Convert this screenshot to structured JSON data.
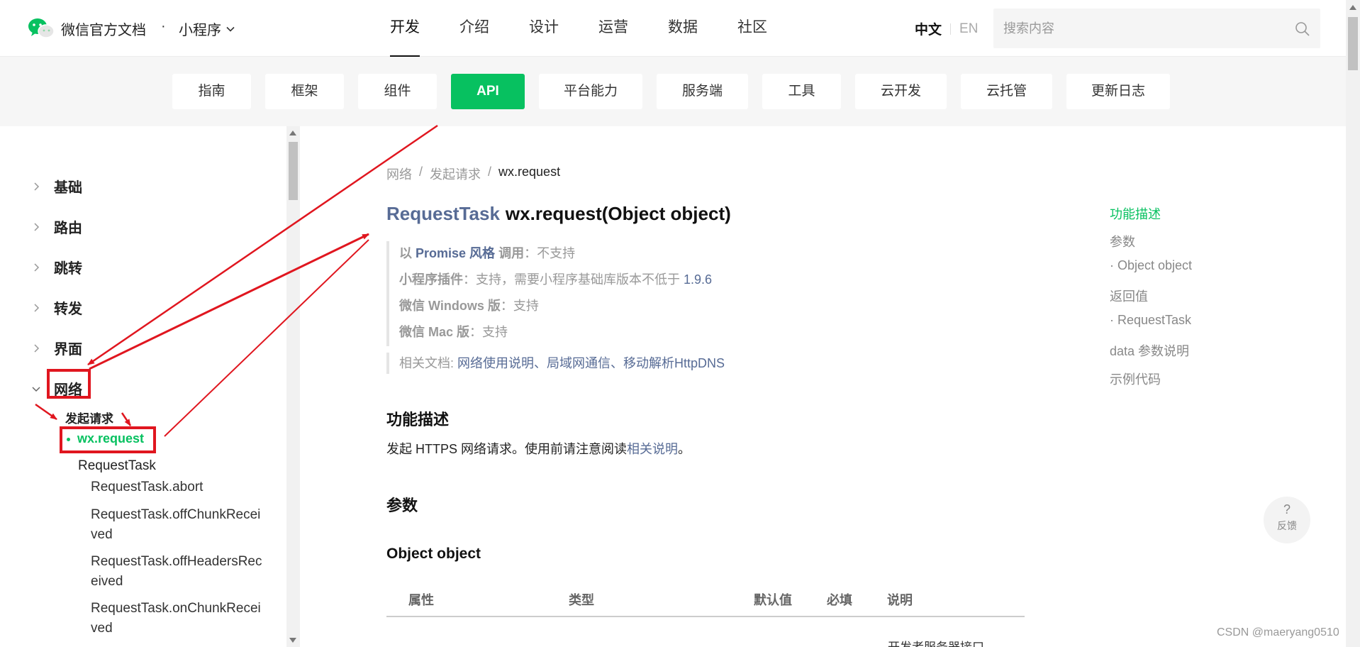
{
  "header": {
    "brand": "微信官方文档",
    "dot": "·",
    "section": "小程序",
    "nav": [
      "开发",
      "介绍",
      "设计",
      "运营",
      "数据",
      "社区"
    ],
    "active_nav": 0,
    "lang_zh": "中文",
    "lang_en": "EN",
    "search_placeholder": "搜索内容"
  },
  "categories": {
    "items": [
      "指南",
      "框架",
      "组件",
      "API",
      "平台能力",
      "服务端",
      "工具",
      "云开发",
      "云托管",
      "更新日志"
    ],
    "active": 3
  },
  "sidebar": {
    "groups": [
      "基础",
      "路由",
      "跳转",
      "转发",
      "界面",
      "网络"
    ],
    "expanded": "网络",
    "sub_group": "发起请求",
    "current": "wx.request",
    "class_item": "RequestTask",
    "leaves": [
      "RequestTask.abort",
      "RequestTask.offChunkReceived",
      "RequestTask.offHeadersReceived",
      "RequestTask.onChunkReceived"
    ]
  },
  "content": {
    "breadcrumb": [
      "网络",
      "发起请求",
      "wx.request"
    ],
    "breadcrumb_sep": "/",
    "title_type": "RequestTask",
    "title_sig": "wx.request(Object object)",
    "support": {
      "promise_prefix": "以",
      "promise_hl": "Promise 风格",
      "promise_suffix": "调用",
      "promise_value": "：不支持",
      "plugin_label": "小程序插件",
      "plugin_value": "：支持，需要小程序基础库版本不低于",
      "plugin_version": "1.9.6",
      "windows_label": "微信 Windows 版",
      "windows_value": "：支持",
      "mac_label": "微信 Mac 版",
      "mac_value": "：支持"
    },
    "related_label": "相关文档: ",
    "related_links": "网络使用说明、局域网通信、移动解析HttpDNS",
    "h_func": "功能描述",
    "desc_text": "发起 HTTPS 网络请求。使用前请注意阅读",
    "desc_link": "相关说明",
    "desc_end": "。",
    "h_params": "参数",
    "h_object": "Object object",
    "table_headers": [
      "属性",
      "类型",
      "默认值",
      "必填",
      "说明"
    ],
    "row_peek": "开发者服务器接口"
  },
  "toc": [
    "功能描述",
    "参数",
    "· Object object",
    "返回值",
    "· RequestTask",
    "data 参数说明",
    "示例代码"
  ],
  "feedback": {
    "q": "?",
    "label": "反馈"
  },
  "watermark": "CSDN @maeryang0510",
  "colors": {
    "accent": "#07c160",
    "link": "#576b95",
    "annotation": "#e0161f"
  }
}
